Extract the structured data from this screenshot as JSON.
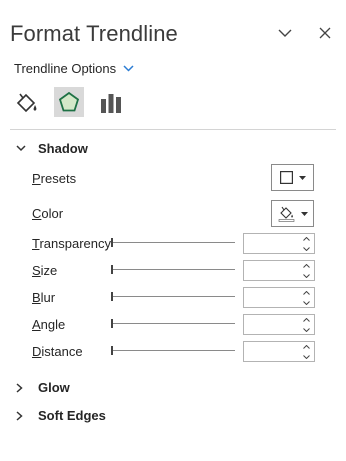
{
  "pane": {
    "title": "Format Trendline",
    "options_label": "Trendline Options",
    "tabs": [
      {
        "name": "fill-line",
        "icon": "paint-bucket-icon",
        "active": false
      },
      {
        "name": "effects",
        "icon": "pentagon-icon",
        "active": true
      },
      {
        "name": "trendline-options",
        "icon": "bar-chart-icon",
        "active": false
      }
    ]
  },
  "shadow": {
    "heading": "Shadow",
    "presets": {
      "label_key": "P",
      "label_rest": "resets"
    },
    "color": {
      "label_key": "C",
      "label_rest": "olor"
    },
    "sliders": [
      {
        "key": "T",
        "rest": "ransparency",
        "value": ""
      },
      {
        "key": "S",
        "rest": "ize",
        "value": ""
      },
      {
        "key": "B",
        "rest": "lur",
        "value": ""
      },
      {
        "key": "A",
        "rest": "ngle",
        "value": ""
      },
      {
        "key": "D",
        "rest": "istance",
        "value": ""
      }
    ]
  },
  "glow": {
    "heading": "Glow"
  },
  "soft_edges": {
    "heading": "Soft Edges"
  },
  "colors": {
    "accent": "#2b7cd3",
    "active_tab": "#d9d9d9",
    "pentagon_fill": "#d4e8c9",
    "pentagon_stroke": "#1e7145"
  }
}
